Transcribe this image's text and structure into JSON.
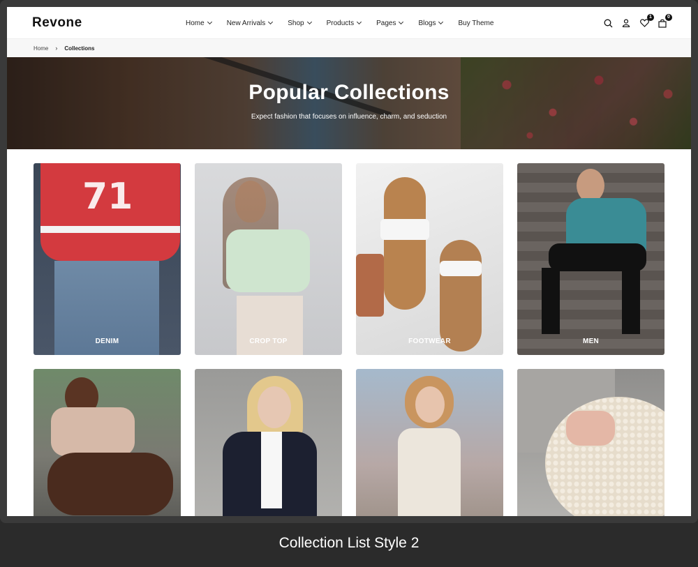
{
  "header": {
    "logo": "Revone",
    "nav": [
      {
        "label": "Home"
      },
      {
        "label": "New Arrivals"
      },
      {
        "label": "Shop"
      },
      {
        "label": "Products"
      },
      {
        "label": "Pages"
      },
      {
        "label": "Blogs"
      },
      {
        "label": "Buy Theme"
      }
    ],
    "wishlist_count": "1",
    "cart_count": "0"
  },
  "breadcrumb": {
    "home": "Home",
    "current": "Collections"
  },
  "hero": {
    "title": "Popular Collections",
    "subtitle": "Expect fashion that focuses on influence, charm, and seduction"
  },
  "collections": [
    {
      "label": "DENIM"
    },
    {
      "label": "CROP TOP"
    },
    {
      "label": "FOOTWEAR"
    },
    {
      "label": "MEN"
    },
    {
      "label": ""
    },
    {
      "label": ""
    },
    {
      "label": ""
    },
    {
      "label": ""
    }
  ],
  "caption": "Collection List Style 2"
}
